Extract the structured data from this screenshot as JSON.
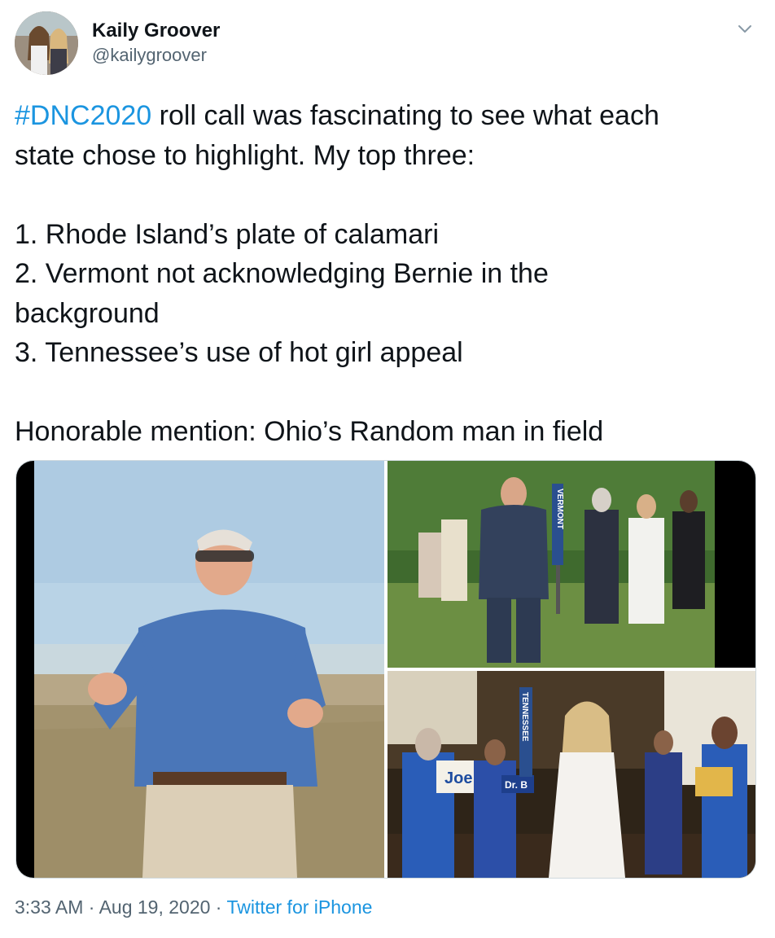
{
  "user": {
    "display_name": "Kaily Groover",
    "handle": "@kailygroover"
  },
  "menu_icon": "chevron-down-icon",
  "tweet": {
    "hashtag": "#DNC2020",
    "line1_rest": " roll call was fascinating to see what each",
    "line2": "state chose to highlight. My top three:",
    "item1": "1. Rhode Island’s plate of calamari",
    "item2a": "2. Vermont not acknowledging Bernie in the",
    "item2b": "background",
    "item3": "3. Tennessee’s use of hot girl appeal",
    "honorable": "Honorable mention: Ohio’s Random man in field"
  },
  "media": {
    "vermont_sign": "VERMONT",
    "tennessee_sign": "TENNESSEE",
    "joe_sign": "Joe",
    "dr_sign": "Dr. B"
  },
  "meta": {
    "time": "3:33 AM",
    "separator": " · ",
    "date": "Aug 19, 2020",
    "source": "Twitter for iPhone"
  },
  "colors": {
    "link": "#1b95e0",
    "text": "#0f1419",
    "secondary": "#536471"
  }
}
